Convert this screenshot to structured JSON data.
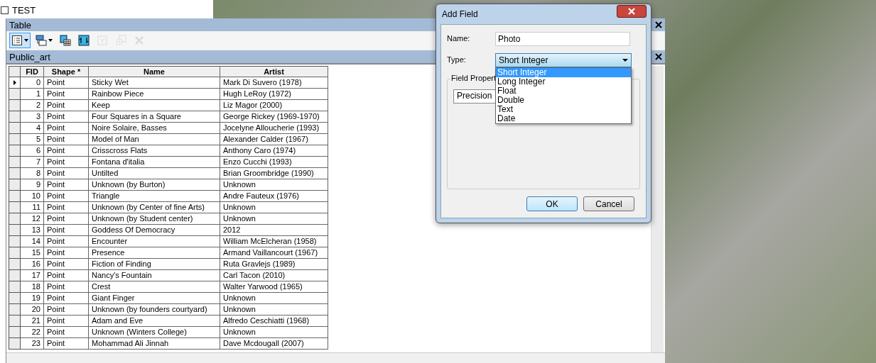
{
  "toc": {
    "items": [
      {
        "label": "TEST",
        "checked": false
      }
    ]
  },
  "table_window": {
    "title": "Table",
    "toolbar": [
      {
        "kind": "table-options",
        "disabled": false,
        "selected": true,
        "dropdown": true
      },
      {
        "kind": "related-tables",
        "disabled": false,
        "selected": false,
        "dropdown": true
      },
      {
        "kind": "select-by-attributes",
        "disabled": false,
        "selected": false,
        "dropdown": false
      },
      {
        "kind": "switch-selection",
        "disabled": false,
        "selected": false,
        "dropdown": false
      },
      {
        "kind": "clear-selection",
        "disabled": true,
        "selected": false,
        "dropdown": false
      },
      {
        "kind": "zoom-to-selected",
        "disabled": true,
        "selected": false,
        "dropdown": false
      },
      {
        "kind": "delete-selected",
        "disabled": true,
        "selected": false,
        "dropdown": false
      }
    ],
    "tab": "Public_art",
    "columns": [
      "FID",
      "Shape *",
      "Name",
      "Artist"
    ],
    "rows": [
      {
        "fid": "0",
        "shape": "Point",
        "name": "Sticky Wet",
        "artist": "Mark Di Suvero (1978)",
        "current": true
      },
      {
        "fid": "1",
        "shape": "Point",
        "name": "Rainbow Piece",
        "artist": "Hugh LeRoy (1972)",
        "current": false
      },
      {
        "fid": "2",
        "shape": "Point",
        "name": "Keep",
        "artist": "Liz Magor (2000)",
        "current": false
      },
      {
        "fid": "3",
        "shape": "Point",
        "name": "Four Squares in a Square",
        "artist": "George Rickey (1969-1970)",
        "current": false
      },
      {
        "fid": "4",
        "shape": "Point",
        "name": "Noire Solaire, Basses",
        "artist": "Jocelyne Alloucherie (1993)",
        "current": false
      },
      {
        "fid": "5",
        "shape": "Point",
        "name": "Model of Man",
        "artist": "Alexander Calder (1967)",
        "current": false
      },
      {
        "fid": "6",
        "shape": "Point",
        "name": "Crisscross Flats",
        "artist": "Anthony Caro (1974)",
        "current": false
      },
      {
        "fid": "7",
        "shape": "Point",
        "name": "Fontana d'italia",
        "artist": "Enzo Cucchi (1993)",
        "current": false
      },
      {
        "fid": "8",
        "shape": "Point",
        "name": "Untilted",
        "artist": "Brian Groombridge (1990)",
        "current": false
      },
      {
        "fid": "9",
        "shape": "Point",
        "name": "Unknown (by Burton)",
        "artist": "Unknown",
        "current": false
      },
      {
        "fid": "10",
        "shape": "Point",
        "name": "Triangle",
        "artist": "Andre Fauteux (1976)",
        "current": false
      },
      {
        "fid": "11",
        "shape": "Point",
        "name": "Unknown (by Center of fine Arts)",
        "artist": "Unknown",
        "current": false
      },
      {
        "fid": "12",
        "shape": "Point",
        "name": "Unknown (by Student center)",
        "artist": "Unknown",
        "current": false
      },
      {
        "fid": "13",
        "shape": "Point",
        "name": "Goddess Of Democracy",
        "artist": "2012",
        "current": false
      },
      {
        "fid": "14",
        "shape": "Point",
        "name": "Encounter",
        "artist": "William McElcheran (1958)",
        "current": false
      },
      {
        "fid": "15",
        "shape": "Point",
        "name": "Presence",
        "artist": "Armand Vaillancourt (1967)",
        "current": false
      },
      {
        "fid": "16",
        "shape": "Point",
        "name": "Fiction of Finding",
        "artist": "Ruta Gravlejs (1989)",
        "current": false
      },
      {
        "fid": "17",
        "shape": "Point",
        "name": "Nancy's Fountain",
        "artist": "Carl Tacon (2010)",
        "current": false
      },
      {
        "fid": "18",
        "shape": "Point",
        "name": "Crest",
        "artist": "Walter Yarwood (1965)",
        "current": false
      },
      {
        "fid": "19",
        "shape": "Point",
        "name": "Giant Finger",
        "artist": "Unknown",
        "current": false
      },
      {
        "fid": "20",
        "shape": "Point",
        "name": "Unknown (by founders courtyard)",
        "artist": "Unknown",
        "current": false
      },
      {
        "fid": "21",
        "shape": "Point",
        "name": "Adam and Eve",
        "artist": "Alfredo Ceschiatti (1968)",
        "current": false
      },
      {
        "fid": "22",
        "shape": "Point",
        "name": "Unknown (Winters College)",
        "artist": "Unknown",
        "current": false
      },
      {
        "fid": "23",
        "shape": "Point",
        "name": "Mohammad Ali Jinnah",
        "artist": "Dave Mcdougall (2007)",
        "current": false
      }
    ]
  },
  "dialog": {
    "title": "Add Field",
    "name_label": "Name:",
    "name_value": "Photo",
    "type_label": "Type:",
    "type_value": "Short Integer",
    "type_options": [
      {
        "label": "Short Integer",
        "selected": true
      },
      {
        "label": "Long Integer",
        "selected": false
      },
      {
        "label": "Float",
        "selected": false
      },
      {
        "label": "Double",
        "selected": false
      },
      {
        "label": "Text",
        "selected": false
      },
      {
        "label": "Date",
        "selected": false
      }
    ],
    "group_title": "Field Propert",
    "property": "Precision",
    "buttons": [
      {
        "label": "OK",
        "default": true
      },
      {
        "label": "Cancel",
        "default": false
      }
    ]
  }
}
